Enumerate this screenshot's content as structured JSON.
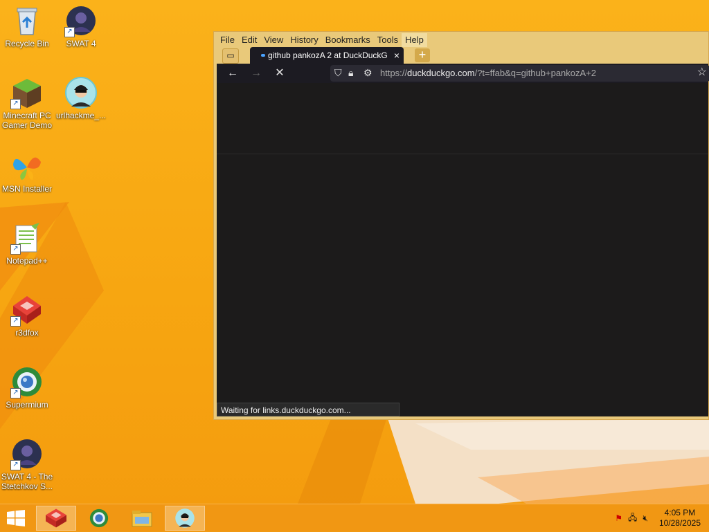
{
  "desktop": {
    "icons": [
      {
        "label": "Recycle Bin"
      },
      {
        "label": "SWAT 4"
      },
      {
        "label": "Minecraft PC Gamer Demo"
      },
      {
        "label": "urlhackme_..."
      },
      {
        "label": "MSN Installer"
      },
      {
        "label": "Notepad++"
      },
      {
        "label": "r3dfox"
      },
      {
        "label": "Supermium"
      },
      {
        "label": "SWAT 4 - The Stetchkov S..."
      }
    ]
  },
  "browser": {
    "menu": [
      "File",
      "Edit",
      "View",
      "History",
      "Bookmarks",
      "Tools",
      "Help"
    ],
    "tab": {
      "title": "github pankozA 2 at DuckDuckG",
      "close": "×"
    },
    "new_tab": "+",
    "url_prefix": "https://",
    "url_host": "duckduckgo.com",
    "url_rest": "/?t=ffab&q=github+pankozA+2",
    "status": "Waiting for links.duckduckgo.com..."
  },
  "taskbar": {
    "clock_time": "4:05 PM",
    "clock_date": "10/28/2025"
  },
  "colors": {
    "wallpaper": "#f6a512",
    "window_frame": "#e9c97a",
    "browser_dark": "#1c1b22",
    "content_bg": "#1c1b1b",
    "taskbar": "#f09614"
  }
}
